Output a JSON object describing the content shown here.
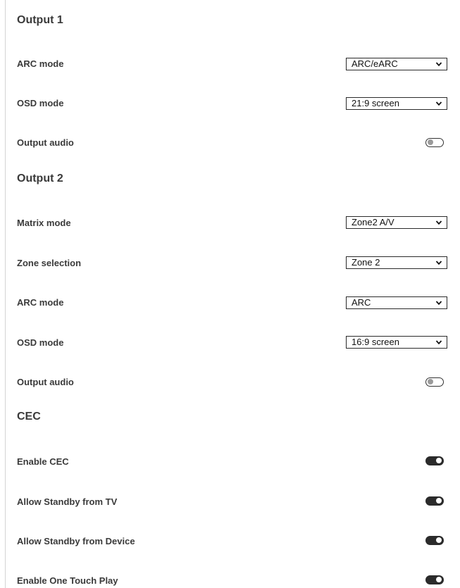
{
  "output1": {
    "title": "Output 1",
    "arc_mode": {
      "label": "ARC mode",
      "value": "ARC/eARC"
    },
    "osd_mode": {
      "label": "OSD mode",
      "value": "21:9 screen"
    },
    "output_audio": {
      "label": "Output audio",
      "enabled": false
    }
  },
  "output2": {
    "title": "Output 2",
    "matrix_mode": {
      "label": "Matrix mode",
      "value": "Zone2 A/V"
    },
    "zone_selection": {
      "label": "Zone selection",
      "value": "Zone 2"
    },
    "arc_mode": {
      "label": "ARC mode",
      "value": "ARC"
    },
    "osd_mode": {
      "label": "OSD mode",
      "value": "16:9 screen"
    },
    "output_audio": {
      "label": "Output audio",
      "enabled": false
    }
  },
  "cec": {
    "title": "CEC",
    "enable_cec": {
      "label": "Enable CEC",
      "enabled": true
    },
    "allow_standby_tv": {
      "label": "Allow Standby from TV",
      "enabled": true
    },
    "allow_standby_device": {
      "label": "Allow Standby from Device",
      "enabled": true
    },
    "enable_one_touch_play": {
      "label": "Enable One Touch Play",
      "enabled": true
    }
  },
  "icons": {
    "dropdown": "chevron-down-icon"
  },
  "colors": {
    "text": "#3a3a3a",
    "toggle_on": "#2b2b2b",
    "toggle_off_knob": "#9a9a9a"
  }
}
